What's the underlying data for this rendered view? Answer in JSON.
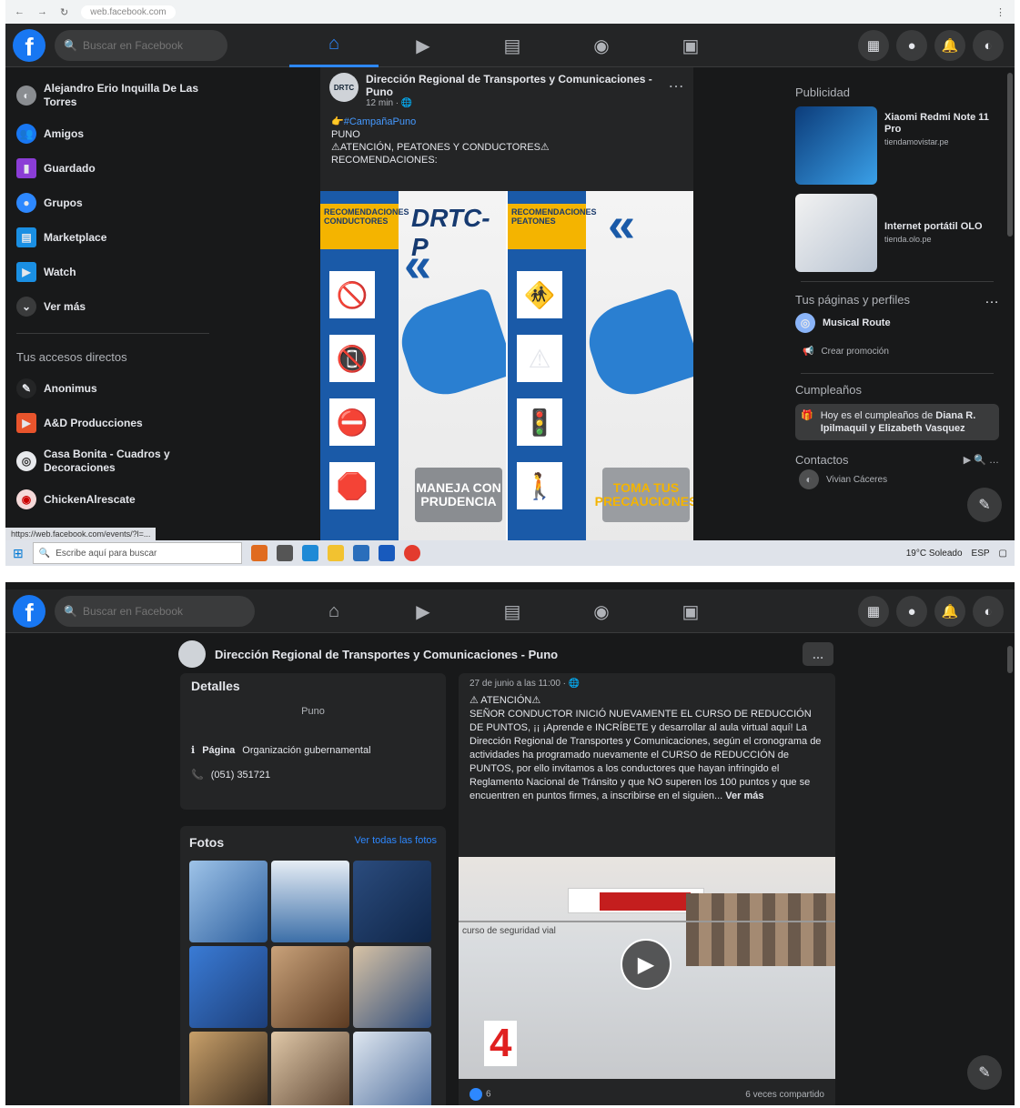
{
  "shot1": {
    "chrome": {
      "url": "web.facebook.com"
    },
    "search": {
      "placeholder": "Buscar en Facebook"
    },
    "left_nav": [
      {
        "label": "Alejandro Erio Inquilla De Las Torres",
        "icon": "avatar"
      },
      {
        "label": "Amigos",
        "icon": "friends-icon"
      },
      {
        "label": "Guardado",
        "icon": "bookmark-icon"
      },
      {
        "label": "Grupos",
        "icon": "groups-icon"
      },
      {
        "label": "Marketplace",
        "icon": "marketplace-icon"
      },
      {
        "label": "Watch",
        "icon": "watch-icon"
      },
      {
        "label": "Ver más",
        "icon": "chevron-down-icon"
      }
    ],
    "shortcuts_heading": "Tus accesos directos",
    "shortcuts": [
      {
        "label": "Anonimus"
      },
      {
        "label": "A&D Producciones"
      },
      {
        "label": "Casa Bonita - Cuadros y Decoraciones"
      },
      {
        "label": "ChickenAlrescate"
      }
    ],
    "status_url": "https://web.facebook.com/events/?l=...",
    "post": {
      "author": "Dirección Regional de Transportes y Comunicaciones - Puno",
      "avatar_text": "DRTC",
      "time": "12 min",
      "hashtag": "#CampañaPuno",
      "line1": "PUNO",
      "line2": "⚠ATENCIÓN, PEATONES Y CONDUCTORES⚠",
      "line3": "RECOMENDACIONES:",
      "img_left_badge": "RECOMENDACIONES CONDUCTORES",
      "img_left_title": "DRTC-P",
      "img_left_cta": "MANEJA CON PRUDENCIA",
      "img_right_badge": "RECOMENDACIONES PEATONES",
      "img_right_cta": "TOMA TUS PRECAUCIONES"
    },
    "right": {
      "ads_heading": "Publicidad",
      "ads": [
        {
          "title": "Xiaomi Redmi Note 11 Pro",
          "site": "tiendamovistar.pe"
        },
        {
          "title": "Internet portátil OLO",
          "site": "tienda.olo.pe"
        }
      ],
      "pages_heading": "Tus páginas y perfiles",
      "page_name": "Musical Route",
      "promo_label": "Crear promoción",
      "bday_heading": "Cumpleaños",
      "bday_text": "Hoy es el cumpleaños de",
      "bday_names": "Diana R. Ipilmaquil y Elizabeth Vasquez",
      "contacts_heading": "Contactos",
      "contact_name": "Vivian Cáceres"
    },
    "taskbar": {
      "search_placeholder": "Escribe aquí para buscar",
      "weather": "19°C Soleado",
      "lang": "ESP"
    }
  },
  "shot2": {
    "search": {
      "placeholder": "Buscar en Facebook"
    },
    "page_title": "Dirección Regional de Transportes y Comunicaciones - Puno",
    "details": {
      "heading": "Detalles",
      "city": "Puno",
      "category_label": "Página",
      "category": "Organización gubernamental",
      "phone": "(051) 351721"
    },
    "photos": {
      "heading": "Fotos",
      "see_all": "Ver todas las fotos"
    },
    "post": {
      "date": "27 de junio a las 11:00",
      "title": "⚠ ATENCIÓN⚠",
      "body": "SEÑOR CONDUCTOR INICIÓ NUEVAMENTE EL CURSO DE REDUCCIÓN DE PUNTOS, ¡¡ ¡Aprende e INCRÍBETE y desarrollar al aula virtual aquí! La Dirección Regional de Transportes y Comunicaciones, según el cronograma de actividades ha programado nuevamente el CURSO de REDUCCIÓN de PUNTOS, por ello invitamos a los conductores que hayan infringido el Reglamento Nacional de Tránsito y que NO superen los 100 puntos y que se encuentren en puntos firmes, a inscribirse en el siguien...",
      "more": "Ver más",
      "video_caption": "curso de seguridad vial",
      "video_number": "4",
      "reactions": "6",
      "shares": "6 veces compartido"
    }
  }
}
